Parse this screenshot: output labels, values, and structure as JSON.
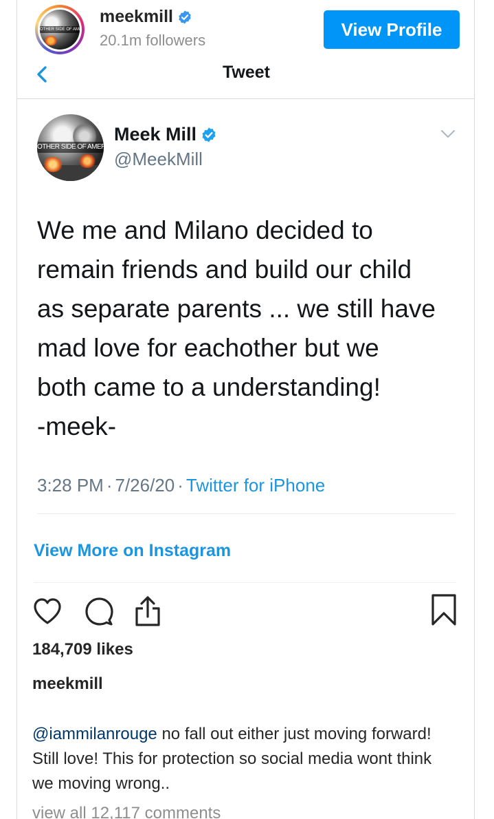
{
  "header": {
    "username": "meekmill",
    "followers": "20.1m followers",
    "view_profile_label": "View Profile",
    "avatar_text": "OTHER SIDE OF AMERICA"
  },
  "tweet": {
    "title": "Tweet",
    "name": "Meek Mill",
    "handle": "@MeekMill",
    "avatar_text": "OTHER SIDE OF AMERICA",
    "text": "We me and Milano decided to\nremain friends and build our child\nas separate parents ... we still have\nmad love for eachother but we\nboth came to a understanding!\n-meek-",
    "time": "3:28 PM",
    "date": "7/26/20",
    "separator": "·",
    "source": "Twitter for iPhone"
  },
  "embed": {
    "view_more_label": "View More on Instagram"
  },
  "post": {
    "likes": "184,709 likes",
    "owner": "meekmill",
    "caption_mention": "@iammilanrouge",
    "caption_text": " no fall out either just moving forward! Still love! This for protection so social media wont think we moving wrong..",
    "view_all_comments": "view all 12,117 comments"
  },
  "icons": {
    "back": "chevron-left-icon",
    "verified": "verified-badge-icon",
    "menu": "chevron-down-icon",
    "like": "heart-icon",
    "comment": "comment-icon",
    "share": "share-icon",
    "save": "bookmark-icon"
  },
  "colors": {
    "instagram_blue": "#0095f6",
    "twitter_blue": "#1b95e0",
    "verified_blue": "#3897f0",
    "text_dark": "#262626",
    "text_muted": "#8e8e8e",
    "twitter_grey": "#657786",
    "mention": "#00376b"
  }
}
